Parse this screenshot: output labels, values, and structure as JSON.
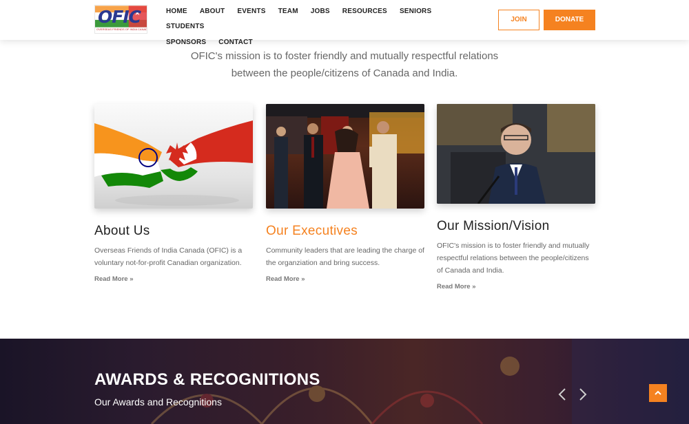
{
  "brand": {
    "logo_text": "OFIC",
    "logo_subtitle": "OVERSEAS FRIENDS OF INDIA CANADA"
  },
  "nav": {
    "row1": [
      "HOME",
      "ABOUT",
      "EVENTS",
      "TEAM",
      "JOBS",
      "RESOURCES",
      "SENIORS",
      "STUDENTS"
    ],
    "row2": [
      "SPONSORS",
      "CONTACT"
    ]
  },
  "actions": {
    "join": "JOIN",
    "donate": "DONATE"
  },
  "mission_statement": {
    "line1": "OFIC's mission is to foster friendly and mutually respectful relations",
    "line2": "between the people/citizens of Canada and India."
  },
  "cards": [
    {
      "title": "About Us",
      "text": "Overseas Friends of India Canada (OFIC) is a voluntary not-for-profit Canadian organization.",
      "link": "Read More »"
    },
    {
      "title": "Our Executives",
      "text": "Community leaders that are leading the charge of the organziation and bring success.",
      "link": "Read More »"
    },
    {
      "title": "Our Mission/Vision",
      "text": "OFIC's mission is to foster friendly and mutually respectful relations between the people/citizens of Canada and India.",
      "link": "Read More »"
    }
  ],
  "awards": {
    "title": "AWARDS & RECOGNITIONS",
    "subtitle": "Our Awards and Recognitions"
  },
  "colors": {
    "accent": "#f58220",
    "text_dark": "#222222",
    "text_muted": "#666666"
  },
  "icons": [
    "chevron-left-icon",
    "chevron-right-icon",
    "chevron-up-icon"
  ]
}
